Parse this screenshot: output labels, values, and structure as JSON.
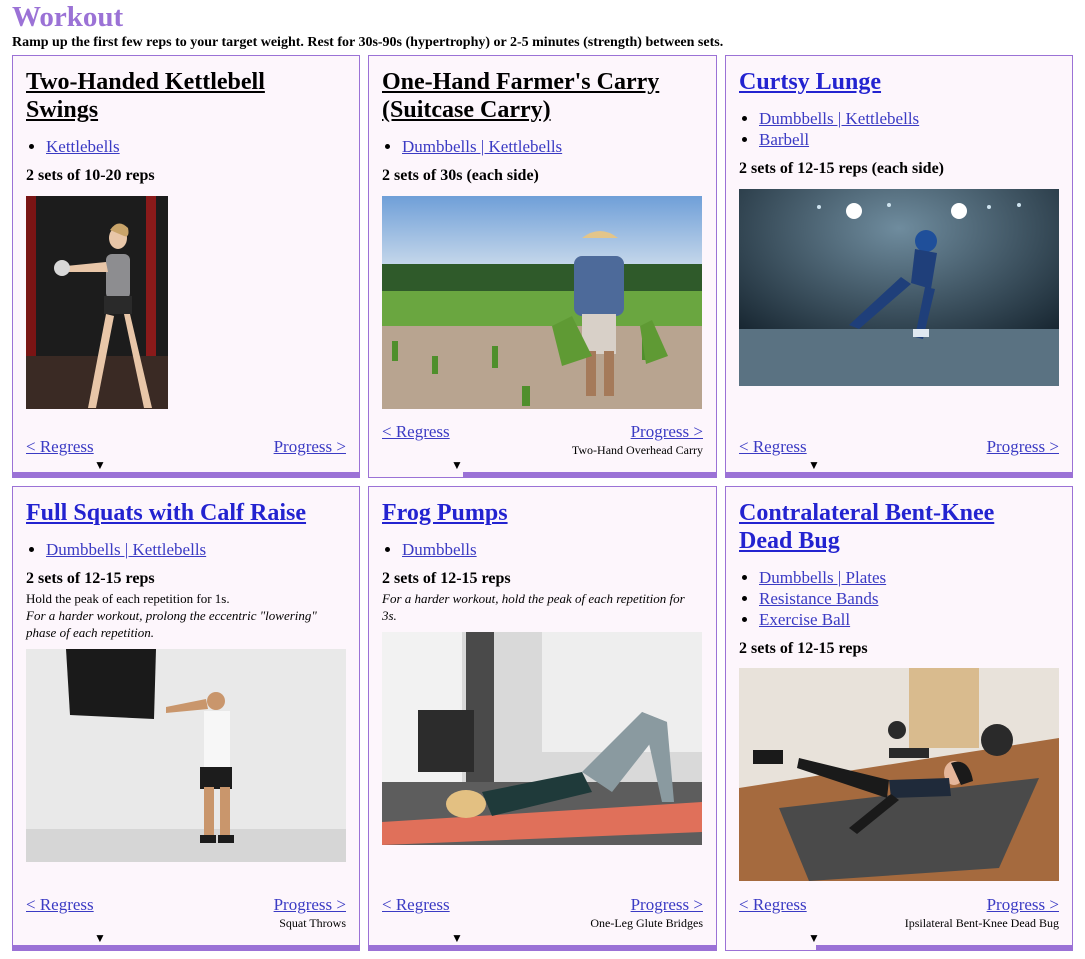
{
  "page": {
    "title": "Workout",
    "subtitle": "Ramp up the first few reps to your target weight. Rest for 30s-90s (hypertrophy) or 2-5 minutes (strength) between sets."
  },
  "colors": {
    "accent": "#9b72d6",
    "link": "#3b3bc4",
    "card_bg": "#fdf6fc"
  },
  "cards": [
    {
      "title": "Two-Handed Kettlebell Swings",
      "equipment": [
        "Kettlebells"
      ],
      "sets": "2 sets of 10-20 reps",
      "regress": "< Regress",
      "progress": "Progress >",
      "progress_next": "",
      "progress_pct": 100
    },
    {
      "title": "One-Hand Farmer's Carry (Suitcase Carry)",
      "equipment": [
        "Dumbbells | Kettlebells"
      ],
      "sets": "2 sets of 30s (each side)",
      "regress": "< Regress",
      "progress": "Progress >",
      "progress_next": "Two-Hand Overhead Carry",
      "progress_pct": 73
    },
    {
      "title": "Curtsy Lunge",
      "equipment": [
        "Dumbbells | Kettlebells",
        "Barbell"
      ],
      "sets": "2 sets of 12-15 reps (each side)",
      "regress": "< Regress",
      "progress": "Progress >",
      "progress_next": "",
      "progress_pct": 100
    },
    {
      "title": "Full Squats with Calf Raise",
      "equipment": [
        "Dumbbells | Kettlebells"
      ],
      "sets": "2 sets of 12-15 reps",
      "note": "Hold the peak of each repetition for 1s.",
      "note_italic": "For a harder workout, prolong the eccentric \"lowering\" phase of each repetition.",
      "regress": "< Regress",
      "progress": "Progress >",
      "progress_next": "Squat Throws",
      "progress_pct": 100
    },
    {
      "title": "Frog Pumps",
      "equipment": [
        "Dumbbells"
      ],
      "sets": "2 sets of 12-15 reps",
      "note_italic": "For a harder workout, hold the peak of each repetition for 3s.",
      "regress": "< Regress",
      "progress": "Progress >",
      "progress_next": "One-Leg Glute Bridges",
      "progress_pct": 100
    },
    {
      "title": "Contralateral Bent-Knee Dead Bug",
      "equipment": [
        "Dumbbells | Plates",
        "Resistance Bands",
        "Exercise Ball"
      ],
      "sets": "2 sets of 12-15 reps",
      "regress": "< Regress",
      "progress": "Progress >",
      "progress_next": "Ipsilateral Bent-Knee Dead Bug",
      "progress_pct": 74
    }
  ],
  "icons": {
    "caret": "caret-down-icon"
  },
  "caret_glyph": "▼"
}
